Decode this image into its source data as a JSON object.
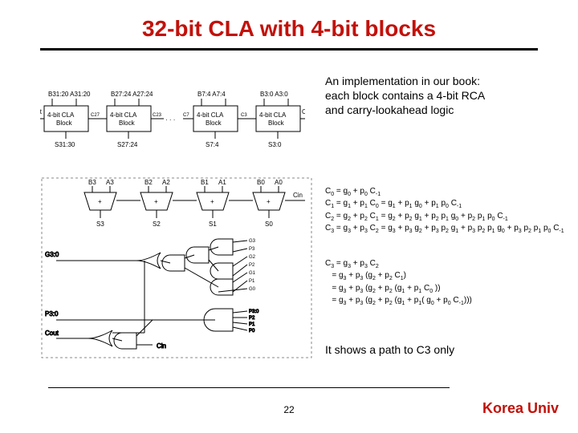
{
  "title": "32-bit CLA with 4-bit blocks",
  "desc_top_line1": "An implementation in our book:",
  "desc_top_line2": "each block contains a 4-bit RCA",
  "desc_top_line3": "and carry-lookahead logic",
  "top_diagram": {
    "inputs": [
      "B31:20  A31:20",
      "B27:24  A27:24",
      "B7:4  A7:4",
      "B3:0  A3:0"
    ],
    "block_label": "4-bit CLA Block",
    "outputs_s": [
      "S31:30",
      "S27:24",
      "S7:4",
      "S3:0"
    ],
    "cout": "Cout",
    "cin": "Cin",
    "carries": [
      "C27",
      "C23",
      "C7",
      "C3"
    ],
    "dots": "· · ·"
  },
  "bottom_diagram": {
    "bit_inputs": [
      [
        "B3",
        "A3"
      ],
      [
        "B2",
        "A2"
      ],
      [
        "B1",
        "A1"
      ],
      [
        "B0",
        "A0"
      ]
    ],
    "cin": "Cin",
    "s": [
      "S3",
      "S2",
      "S1",
      "S0"
    ],
    "cout": "Cout",
    "g_lines": [
      "G3",
      "P3",
      "G2",
      "P2",
      "G1",
      "P1",
      "G0"
    ],
    "gp_out": [
      "G3:0",
      "P3:0"
    ],
    "p_bus": "P3:0",
    "cin_bottom": "Cin"
  },
  "eq_c0": "C<sub>0</sub> = g<sub>0</sub> + p<sub>0</sub> C<sub>-1</sub>",
  "eq_c1": "C<sub>1</sub> = g<sub>1</sub> + p<sub>1</sub> C<sub>0</sub> = g<sub>1</sub> + p<sub>1</sub> g<sub>0</sub> + p<sub>1</sub> p<sub>0</sub> C<sub>-1</sub>",
  "eq_c2": "C<sub>2</sub> = g<sub>2</sub> + p<sub>2</sub> C<sub>1</sub> = g<sub>2</sub> + p<sub>2</sub> g<sub>1</sub> + p<sub>2</sub> p<sub>1</sub> g<sub>0</sub> + p<sub>2</sub> p<sub>1</sub> p<sub>0</sub> C<sub>-1</sub>",
  "eq_c3_a": "C<sub>3</sub> = g<sub>3</sub> + p<sub>3</sub> C<sub>2</sub> = g<sub>3</sub> + p<sub>3</sub> g<sub>2</sub> + p<sub>3</sub> p<sub>2</sub> g<sub>1</sub> + p<sub>3</sub> p<sub>2</sub> p<sub>1</sub> g<sub>0</sub> + p<sub>3</sub> p<sub>2</sub> p<sub>1</sub> p<sub>0</sub> C<sub>-1</sub>",
  "eq_c3_l1": "C<sub>3</sub> = g<sub>3</sub> + p<sub>3</sub> C<sub>2</sub>",
  "eq_c3_l2": "&nbsp;&nbsp;&nbsp;= g<sub>3</sub> + p<sub>3</sub> (g<sub>2</sub> + p<sub>2</sub> C<sub>1</sub>)",
  "eq_c3_l3": "&nbsp;&nbsp;&nbsp;= g<sub>3</sub> + p<sub>3</sub> (g<sub>2</sub> + p<sub>2</sub> (g<sub>1</sub> + p<sub>1</sub> C<sub>0</sub> ))",
  "eq_c3_l4": "&nbsp;&nbsp;&nbsp;= g<sub>3</sub> + p<sub>3</sub> (g<sub>2</sub> + p<sub>2</sub> (g<sub>1</sub> + p<sub>1</sub>( g<sub>0</sub> + p<sub>0</sub> C<sub>-1</sub>)))",
  "bottom_note": "It shows a path to C3 only",
  "page_number": "22",
  "university": "Korea Univ"
}
